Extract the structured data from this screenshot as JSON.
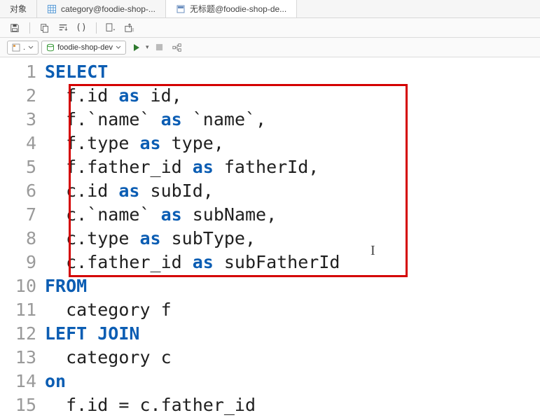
{
  "tabs": {
    "obj": {
      "label": "对象"
    },
    "cat": {
      "label": "category@foodie-shop-..."
    },
    "query": {
      "label": "无标题@foodie-shop-de..."
    }
  },
  "toolbar2": {
    "schema_sel": ".",
    "db_sel": "foodie-shop-dev"
  },
  "code": {
    "l1": {
      "n": "1",
      "a": "SELECT"
    },
    "l2": {
      "n": "2",
      "a": "  f.id ",
      "kw": "as",
      "b": " id,"
    },
    "l3": {
      "n": "3",
      "a": "  f.`name` ",
      "kw": "as",
      "b": " `name`,"
    },
    "l4": {
      "n": "4",
      "a": "  f.type ",
      "kw": "as",
      "b": " type,"
    },
    "l5": {
      "n": "5",
      "a": "  f.father_id ",
      "kw": "as",
      "b": " fatherId,"
    },
    "l6": {
      "n": "6",
      "a": "  c.id ",
      "kw": "as",
      "b": " subId,"
    },
    "l7": {
      "n": "7",
      "a": "  c.`name` ",
      "kw": "as",
      "b": " subName,"
    },
    "l8": {
      "n": "8",
      "a": "  c.type ",
      "kw": "as",
      "b": " subType,"
    },
    "l9": {
      "n": "9",
      "a": "  c.father_id ",
      "kw": "as",
      "b": " subFatherId"
    },
    "l10": {
      "n": "10",
      "a": "FROM"
    },
    "l11": {
      "n": "11",
      "a": "  category f"
    },
    "l12": {
      "n": "12",
      "a": "LEFT JOIN"
    },
    "l13": {
      "n": "13",
      "a": "  category c"
    },
    "l14": {
      "n": "14",
      "a": "on"
    },
    "l15": {
      "n": "15",
      "a": "  f.id = c.father_id"
    }
  }
}
